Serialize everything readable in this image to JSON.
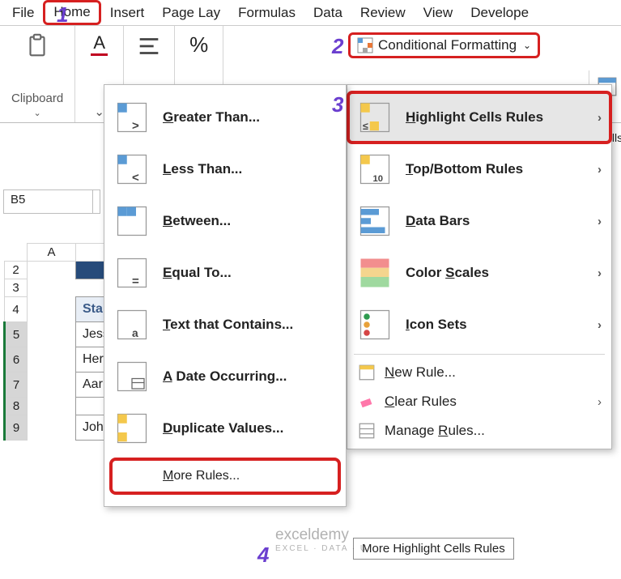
{
  "tabs": {
    "file": "File",
    "home": "Home",
    "insert": "Insert",
    "pagelayout": "Page Lay",
    "formulas": "Formulas",
    "data": "Data",
    "review": "Review",
    "view": "View",
    "developer": "Develope"
  },
  "ribbon": {
    "clipboard_label": "Clipboard",
    "conditional_formatting": "Conditional Formatting",
    "percent_sign": "%",
    "cells_label": "Cells"
  },
  "cf_menu": {
    "highlight": "Highlight Cells Rules",
    "topbottom": "Top/Bottom Rules",
    "databars": "Data Bars",
    "colorscales": "Color Scales",
    "iconsets": "Icon Sets",
    "newrule": "New Rule...",
    "clear": "Clear Rules",
    "manage": "Manage Rules..."
  },
  "highlight_menu": {
    "greater": "Greater Than...",
    "less": "Less Than...",
    "between": "Between...",
    "equal": "Equal To...",
    "textcontains": "Text that Contains...",
    "dateoccurring": "A Date Occurring...",
    "duplicate": "Duplicate Values...",
    "more": "More Rules..."
  },
  "tooltip": "More Highlight Cells Rules",
  "namebox": "B5",
  "sheet": {
    "col_a": "A",
    "rows": [
      "2",
      "3",
      "4",
      "5",
      "6",
      "7",
      "8",
      "9"
    ],
    "header4": "Sta",
    "r5": "Jess",
    "r6": "Her",
    "r7": "Aar",
    "r8": "",
    "r9": "Joh"
  },
  "steps": {
    "s1": "1",
    "s2": "2",
    "s3": "3",
    "s4": "4"
  },
  "watermark": {
    "brand": "exceldemy",
    "tag": "EXCEL · DATA · U"
  }
}
